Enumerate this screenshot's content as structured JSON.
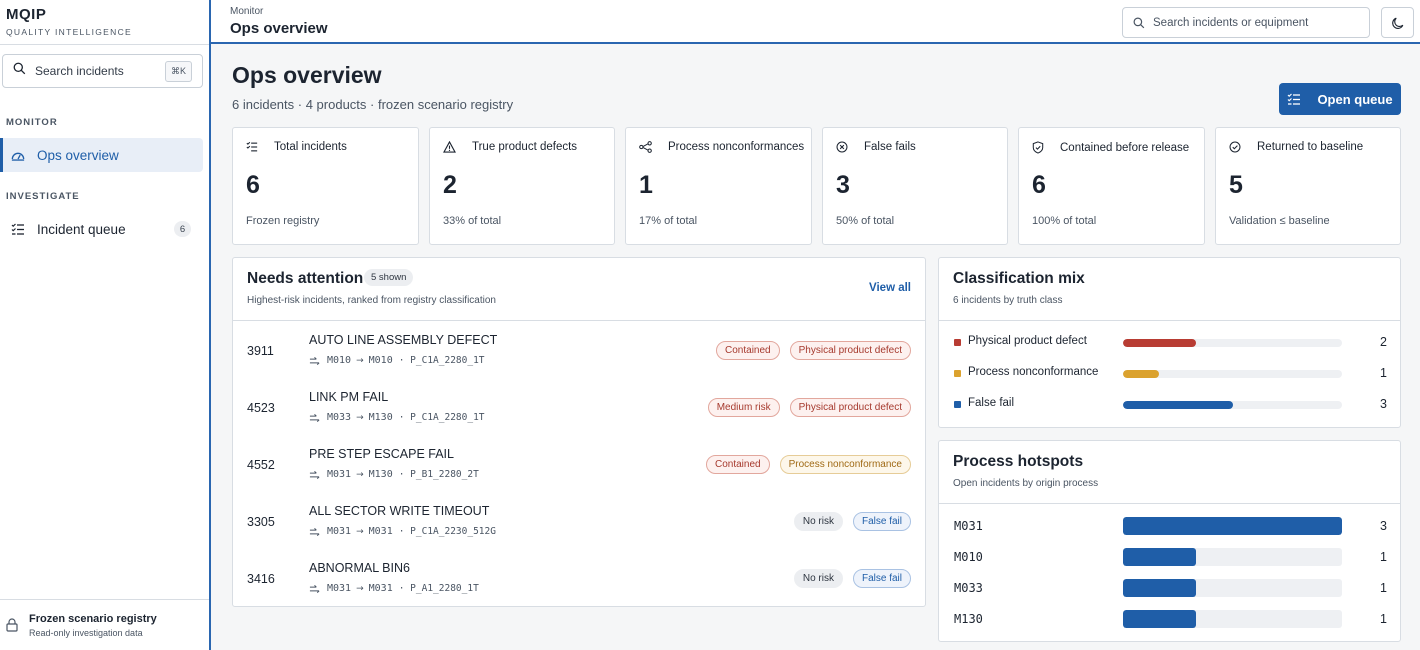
{
  "brand": {
    "title": "MQIP",
    "subtitle": "QUALITY INTELLIGENCE"
  },
  "sidebar": {
    "search_label": "Search incidents",
    "search_shortcut": "⌘K",
    "sections": [
      {
        "label": "MONITOR",
        "items": [
          {
            "label": "Ops overview",
            "active": true,
            "icon": "gauge-icon"
          }
        ]
      },
      {
        "label": "INVESTIGATE",
        "items": [
          {
            "label": "Incident queue",
            "count": "6",
            "icon": "list-icon"
          }
        ]
      }
    ],
    "footer": {
      "title": "Frozen scenario registry",
      "subtitle": "Read-only investigation data"
    }
  },
  "topbar": {
    "breadcrumb": "Monitor",
    "title": "Ops overview",
    "search_placeholder": "Search incidents or equipment"
  },
  "page": {
    "title": "Ops overview",
    "subtitle": "6 incidents · 4 products · frozen scenario registry",
    "primary_button": "Open queue"
  },
  "stats": [
    {
      "label": "Total incidents",
      "value": "6",
      "foot": "Frozen registry",
      "icon": "list-check-icon"
    },
    {
      "label": "True product defects",
      "value": "2",
      "foot": "33% of total",
      "icon": "warning-icon"
    },
    {
      "label": "Process nonconformances",
      "value": "1",
      "foot": "17% of total",
      "icon": "flow-icon"
    },
    {
      "label": "False fails",
      "value": "3",
      "foot": "50% of total",
      "icon": "x-circle-icon"
    },
    {
      "label": "Contained before release",
      "value": "6",
      "foot": "100% of total",
      "icon": "shield-icon"
    },
    {
      "label": "Returned to baseline",
      "value": "5",
      "foot": "Validation ≤ baseline",
      "icon": "check-circle-icon"
    }
  ],
  "attention": {
    "title": "Needs attention",
    "count_chip": "5 shown",
    "subtitle": "Highest-risk incidents, ranked from registry classification",
    "view_all": "View all",
    "rows": [
      {
        "id": "3911",
        "name": "AUTO LINE ASSEMBLY DEFECT",
        "from": "M010",
        "to": "M010",
        "sku": "· P_C1A_2280_1T",
        "badges": [
          {
            "text": "Contained",
            "tone": "red"
          },
          {
            "text": "Physical product defect",
            "tone": "red"
          }
        ]
      },
      {
        "id": "4523",
        "name": "LINK PM FAIL",
        "from": "M033",
        "to": "M130",
        "sku": "· P_C1A_2280_1T",
        "badges": [
          {
            "text": "Medium risk",
            "tone": "red"
          },
          {
            "text": "Physical product defect",
            "tone": "red"
          }
        ]
      },
      {
        "id": "4552",
        "name": "PRE STEP ESCAPE FAIL",
        "from": "M031",
        "to": "M130",
        "sku": "· P_B1_2280_2T",
        "badges": [
          {
            "text": "Contained",
            "tone": "red"
          },
          {
            "text": "Process nonconformance",
            "tone": "amber"
          }
        ]
      },
      {
        "id": "3305",
        "name": "ALL SECTOR WRITE TIMEOUT",
        "from": "M031",
        "to": "M031",
        "sku": "· P_C1A_2230_512G",
        "badges": [
          {
            "text": "No risk",
            "tone": "grey"
          },
          {
            "text": "False fail",
            "tone": "blue"
          }
        ]
      },
      {
        "id": "3416",
        "name": "ABNORMAL BIN6",
        "from": "M031",
        "to": "M031",
        "sku": "· P_A1_2280_1T",
        "badges": [
          {
            "text": "No risk",
            "tone": "grey"
          },
          {
            "text": "False fail",
            "tone": "blue"
          }
        ]
      }
    ]
  },
  "classification": {
    "title": "Classification mix",
    "subtitle": "6 incidents by truth class",
    "max": 6,
    "rows": [
      {
        "label": "Physical product defect",
        "value": 2,
        "color": "#b83c33"
      },
      {
        "label": "Process nonconformance",
        "value": 1,
        "color": "#dba22e"
      },
      {
        "label": "False fail",
        "value": 3,
        "color": "#1f5ea8"
      }
    ]
  },
  "hotspots": {
    "title": "Process hotspots",
    "subtitle": "Open incidents by origin process",
    "max": 3,
    "rows": [
      {
        "label": "M031",
        "value": 3
      },
      {
        "label": "M010",
        "value": 1
      },
      {
        "label": "M033",
        "value": 1
      },
      {
        "label": "M130",
        "value": 1
      }
    ]
  },
  "colors": {
    "accent": "#1f5ea8",
    "defect": "#b83c33",
    "process": "#dba22e"
  }
}
